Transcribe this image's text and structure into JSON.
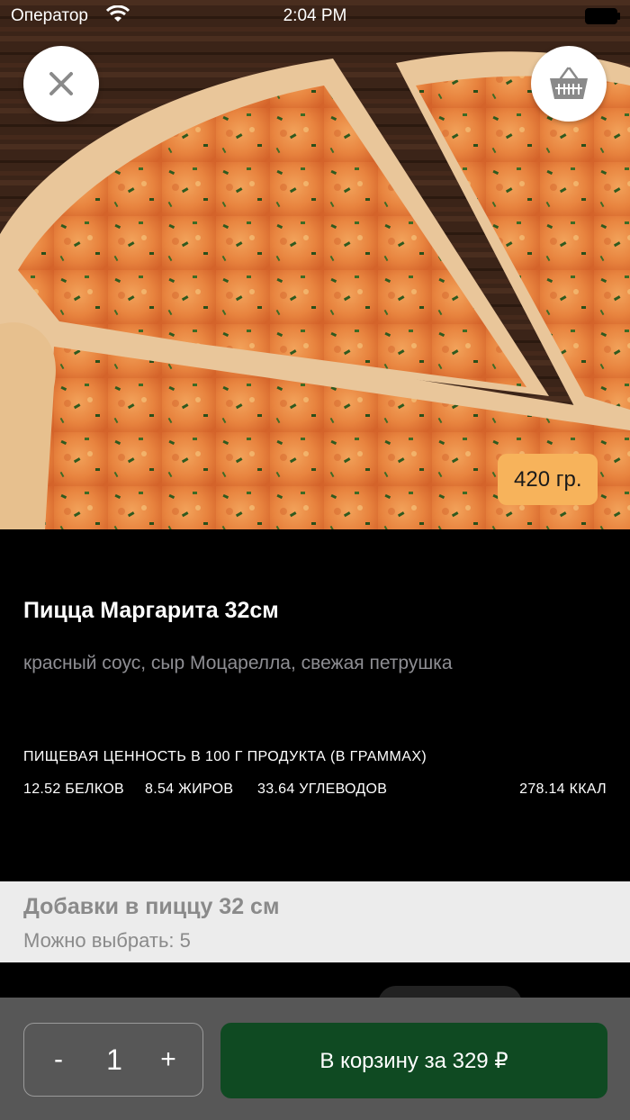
{
  "status_bar": {
    "carrier": "Оператор",
    "time": "2:04 PM",
    "wifi_icon": "wifi-icon",
    "battery_icon": "battery-icon"
  },
  "hero": {
    "close_icon": "close-icon",
    "cart_icon": "basket-icon",
    "weight_badge": "420 гр."
  },
  "product": {
    "title": "Пицца Маргарита 32см",
    "description": "красный соус, сыр Моцарелла, свежая петрушка"
  },
  "nutrition": {
    "header": "ПИЩЕВАЯ ЦЕННОСТЬ В 100 Г ПРОДУКТА (В ГРАММАХ)",
    "protein": "12.52 БЕЛКОВ",
    "fat": "8.54 ЖИРОВ",
    "carbs": "33.64 УГЛЕВОДОВ",
    "kcal": "278.14 ККАЛ"
  },
  "additives": {
    "title": "Добавки в пиццу 32 см",
    "subtitle": "Можно выбрать: 5"
  },
  "bottom_bar": {
    "minus_label": "-",
    "quantity": "1",
    "plus_label": "+",
    "add_to_cart_label": "В корзину за 329 ₽"
  },
  "colors": {
    "badge": "#f7b35b",
    "cart_button": "#0f4a22",
    "bottom_bar": "#575757",
    "additives_bg": "#ececec"
  }
}
